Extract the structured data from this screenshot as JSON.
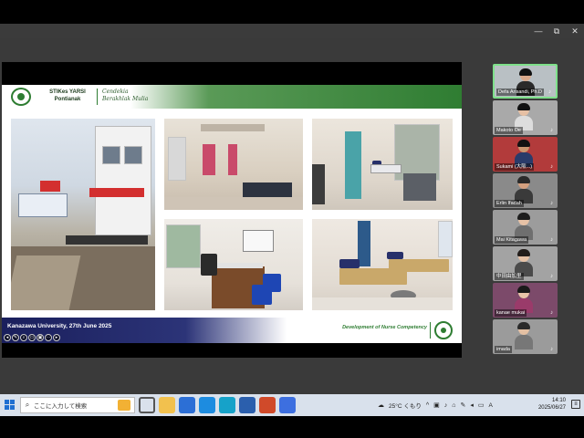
{
  "window": {
    "controls": [
      "—",
      "⧉",
      "✕"
    ]
  },
  "slide": {
    "institution_line1": "STIKes YARSI",
    "institution_line2": "Pontianak",
    "motto_line1": "Cendekia",
    "motto_line2": "Berakhlak Mulia",
    "footer_left": "Kanazawa University, 27th June 2025",
    "footer_right": "Development of Nurse Competency",
    "photos": [
      {
        "caption_sign": "APOTEK KLINIK",
        "board": "PUSAT TERAPI LUKA DIABETES"
      },
      {},
      {},
      {},
      {}
    ],
    "colors": {
      "green": "#2e7d32",
      "navy": "#1a1f5c"
    }
  },
  "participants": [
    {
      "name": "Defa Arisandi, Ph.D",
      "active": true,
      "skin": "#d9a88a",
      "hair": "#111",
      "shirt": "#2a2a2a",
      "bg": "#b9c0c4"
    },
    {
      "name": "Makoto Oe",
      "active": false,
      "skin": "#e6c0a4",
      "hair": "#111",
      "shirt": "#ddd",
      "bg": "#a9a9a9"
    },
    {
      "name": "Sukami (大阪...)",
      "active": false,
      "skin": "#c9956f",
      "hair": "#111",
      "shirt": "#2a3b6a",
      "bg": "#b23b3b"
    },
    {
      "name": "Erlin Ifadah",
      "active": false,
      "skin": "#d4a07f",
      "hair": "#2a2a2a",
      "shirt": "#3a3a3a",
      "bg": "#8a8a8a"
    },
    {
      "name": "Mai Kitagawa",
      "active": false,
      "skin": "#e7c2a6",
      "hair": "#1d1d1d",
      "shirt": "#6f6f6f",
      "bg": "#9c9c9c"
    },
    {
      "name": "中田由加里",
      "active": false,
      "skin": "#e5c1a5",
      "hair": "#221d1a",
      "shirt": "#4b4b4b",
      "bg": "#a3a3a3"
    },
    {
      "name": "kanae mukai",
      "active": false,
      "skin": "#e8c4a8",
      "hair": "#1a1a1a",
      "shirt": "#9a3b6a",
      "bg": "#7c4a6a"
    },
    {
      "name": "imada",
      "active": false,
      "skin": "#e4c0a3",
      "hair": "#2a2a2a",
      "shirt": "#777",
      "bg": "#9b9b9b"
    }
  ],
  "taskbar": {
    "search_placeholder": "ここに入力して検索",
    "weather": "25°C くもり",
    "ime": "A",
    "time": "14:10",
    "date": "2025/06/27"
  }
}
